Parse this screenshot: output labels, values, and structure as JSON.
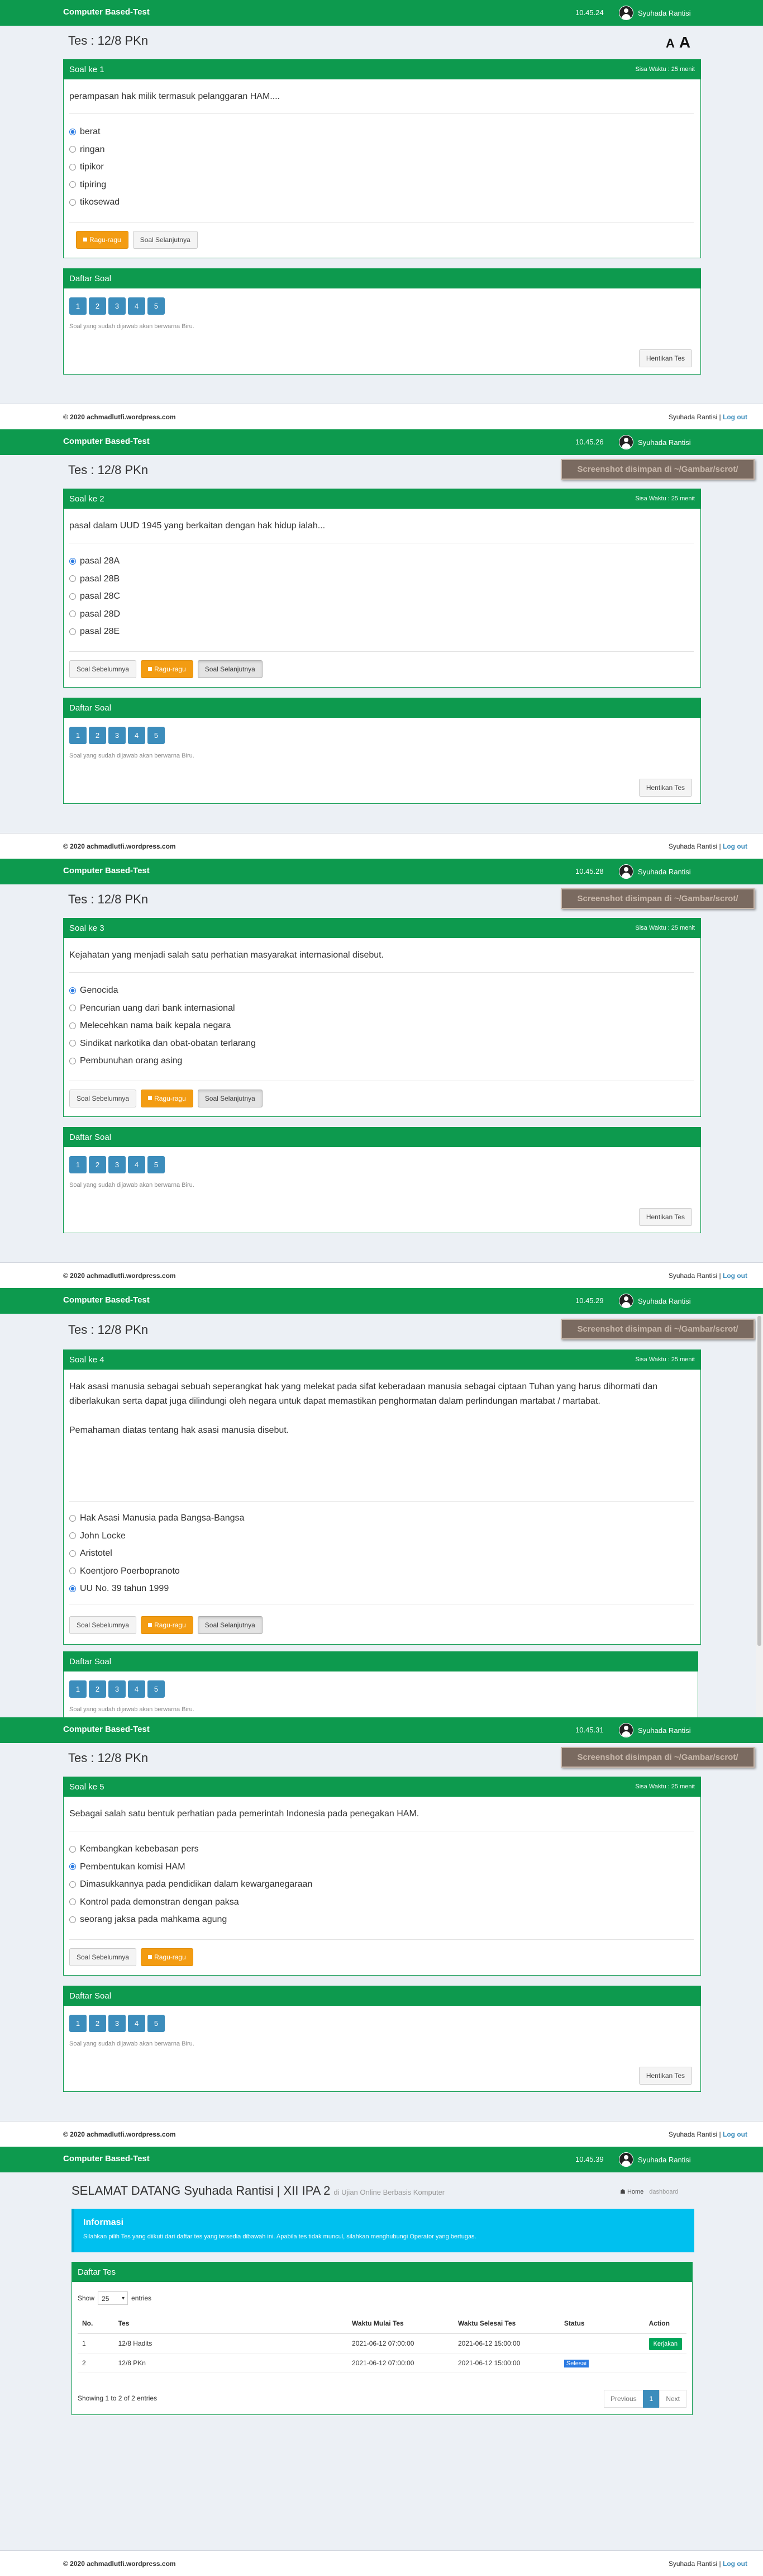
{
  "app": {
    "brand": "Computer Based-Test",
    "user": "Syuhada Rantisi",
    "test_title": "Tes : 12/8 PKn",
    "font_small": "A",
    "font_big": "A",
    "toast": "Screenshot disimpan di ~/Gambar/scrot/",
    "timer": "Sisa Waktu : 25 menit",
    "prev_label": "Soal Sebelumnya",
    "doubt_label": "Ragu-ragu",
    "next_label": "Soal Selanjutnya",
    "list_title": "Daftar Soal",
    "numbers": [
      "1",
      "2",
      "3",
      "4",
      "5"
    ],
    "list_note": "Soal yang sudah dijawab akan berwarna Biru.",
    "stop_label": "Hentikan Tes",
    "footer_left": "© 2020 achmadlutfi.wordpress.com",
    "footer_user": "Syuhada Rantisi",
    "footer_sep": "|",
    "footer_logout": "Log out"
  },
  "screens": [
    {
      "clock": "10.45.24",
      "title": "Soal ke 1",
      "question": "perampasan hak milik termasuk pelanggaran HAM....",
      "options": [
        "berat",
        "ringan",
        "tipikor",
        "tipiring",
        "tikosewad"
      ],
      "selected": 0
    },
    {
      "clock": "10.45.26",
      "title": "Soal ke 2",
      "question": "pasal dalam UUD 1945 yang berkaitan dengan hak hidup ialah...",
      "options": [
        "pasal 28A",
        "pasal 28B",
        "pasal 28C",
        "pasal 28D",
        "pasal 28E"
      ],
      "selected": 0
    },
    {
      "clock": "10.45.28",
      "title": "Soal ke 3",
      "question": "Kejahatan yang menjadi salah satu perhatian masyarakat internasional disebut.",
      "options": [
        "Genocida",
        "Pencurian uang dari bank internasional",
        "Melecehkan nama baik kepala negara",
        "Sindikat narkotika dan obat-obatan terlarang",
        "Pembunuhan orang asing"
      ],
      "selected": 0
    },
    {
      "clock": "10.45.29",
      "title": "Soal ke 4",
      "question_lines": [
        "Hak asasi manusia sebagai sebuah seperangkat hak yang melekat pada sifat keberadaan manusia sebagai ciptaan Tuhan yang harus dihormati dan diberlakukan serta dapat juga dilindungi oleh negara untuk dapat memastikan penghormatan dalam perlindungan martabat / martabat.",
        "Pemahaman diatas tentang hak asasi manusia disebut."
      ],
      "options": [
        "Hak Asasi Manusia pada Bangsa-Bangsa",
        "John Locke",
        "Aristotel",
        "Koentjoro Poerbopranoto",
        "UU No. 39 tahun 1999"
      ],
      "selected": 4
    },
    {
      "clock": "10.45.31",
      "title": "Soal ke 5",
      "question": "Sebagai salah satu bentuk perhatian pada pemerintah Indonesia pada penegakan HAM.",
      "options": [
        "Kembangkan kebebasan pers",
        "Pembentukan komisi HAM",
        "Dimasukkannya pada pendidikan dalam kewarganegaraan",
        "Kontrol pada demonstran dengan paksa",
        "seorang jaksa pada mahkama agung"
      ],
      "selected": 1
    }
  ],
  "dashboard": {
    "clock": "10.45.39",
    "welcome": "SELAMAT DATANG Syuhada Rantisi | XII IPA 2",
    "welcome_sub": "di Ujian Online Berbasis Komputer",
    "crumb_home": "Home",
    "crumb_active": "dashboard",
    "info_title": "Informasi",
    "info_text": "Silahkan pilih Tes yang diikuti dari daftar tes yang tersedia dibawah ini. Apabila tes tidak muncul, silahkan menghubungi Operator yang bertugas.",
    "panel_title": "Daftar Tes",
    "show_label": "Show",
    "show_value": "25",
    "entries_label": "entries",
    "columns": [
      "No.",
      "Tes",
      "Waktu Mulai Tes",
      "Waktu Selesai Tes",
      "Status",
      "Action"
    ],
    "rows": [
      {
        "no": "1",
        "tes": "12/8 Hadits",
        "mulai": "2021-06-12 07:00:00",
        "selesai": "2021-06-12 15:00:00",
        "status": "",
        "action": "Kerjakan"
      },
      {
        "no": "2",
        "tes": "12/8 PKn",
        "mulai": "2021-06-12 07:00:00",
        "selesai": "2021-06-12 15:00:00",
        "status": "Selesai",
        "action": ""
      }
    ],
    "entries_info": "Showing 1 to 2 of 2 entries",
    "prev": "Previous",
    "page": "1",
    "next": "Next"
  }
}
